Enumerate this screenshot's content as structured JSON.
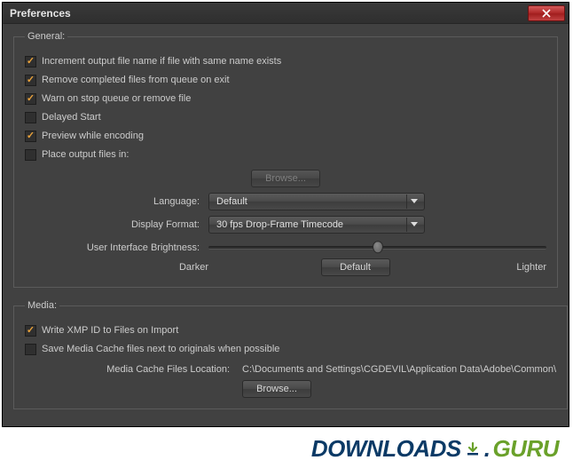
{
  "window": {
    "title": "Preferences"
  },
  "general": {
    "legend": "General:",
    "increment_label": "Increment output file name if file with same name exists",
    "increment_checked": true,
    "remove_label": "Remove completed files from queue on exit",
    "remove_checked": true,
    "warn_label": "Warn on stop queue or remove file",
    "warn_checked": true,
    "delayed_label": "Delayed Start",
    "delayed_checked": false,
    "preview_label": "Preview while encoding",
    "preview_checked": true,
    "placefiles_label": "Place output files in:",
    "placefiles_checked": false,
    "browse_label": "Browse...",
    "language_label": "Language:",
    "language_value": "Default",
    "display_format_label": "Display Format:",
    "display_format_value": "30 fps Drop-Frame Timecode",
    "brightness_label": "User Interface Brightness:",
    "darker_label": "Darker",
    "default_btn": "Default",
    "lighter_label": "Lighter"
  },
  "media": {
    "legend": "Media:",
    "xmp_label": "Write XMP ID to Files on Import",
    "xmp_checked": true,
    "cache_label": "Save Media Cache files next to originals when possible",
    "cache_checked": false,
    "path_label": "Media Cache Files Location:",
    "path_value": "C:\\Documents and Settings\\CGDEVIL\\Application Data\\Adobe\\Common\\",
    "browse_label": "Browse..."
  },
  "watermark": {
    "downloads": "DOWNLOADS",
    "dot": ".",
    "guru": "GURU"
  }
}
